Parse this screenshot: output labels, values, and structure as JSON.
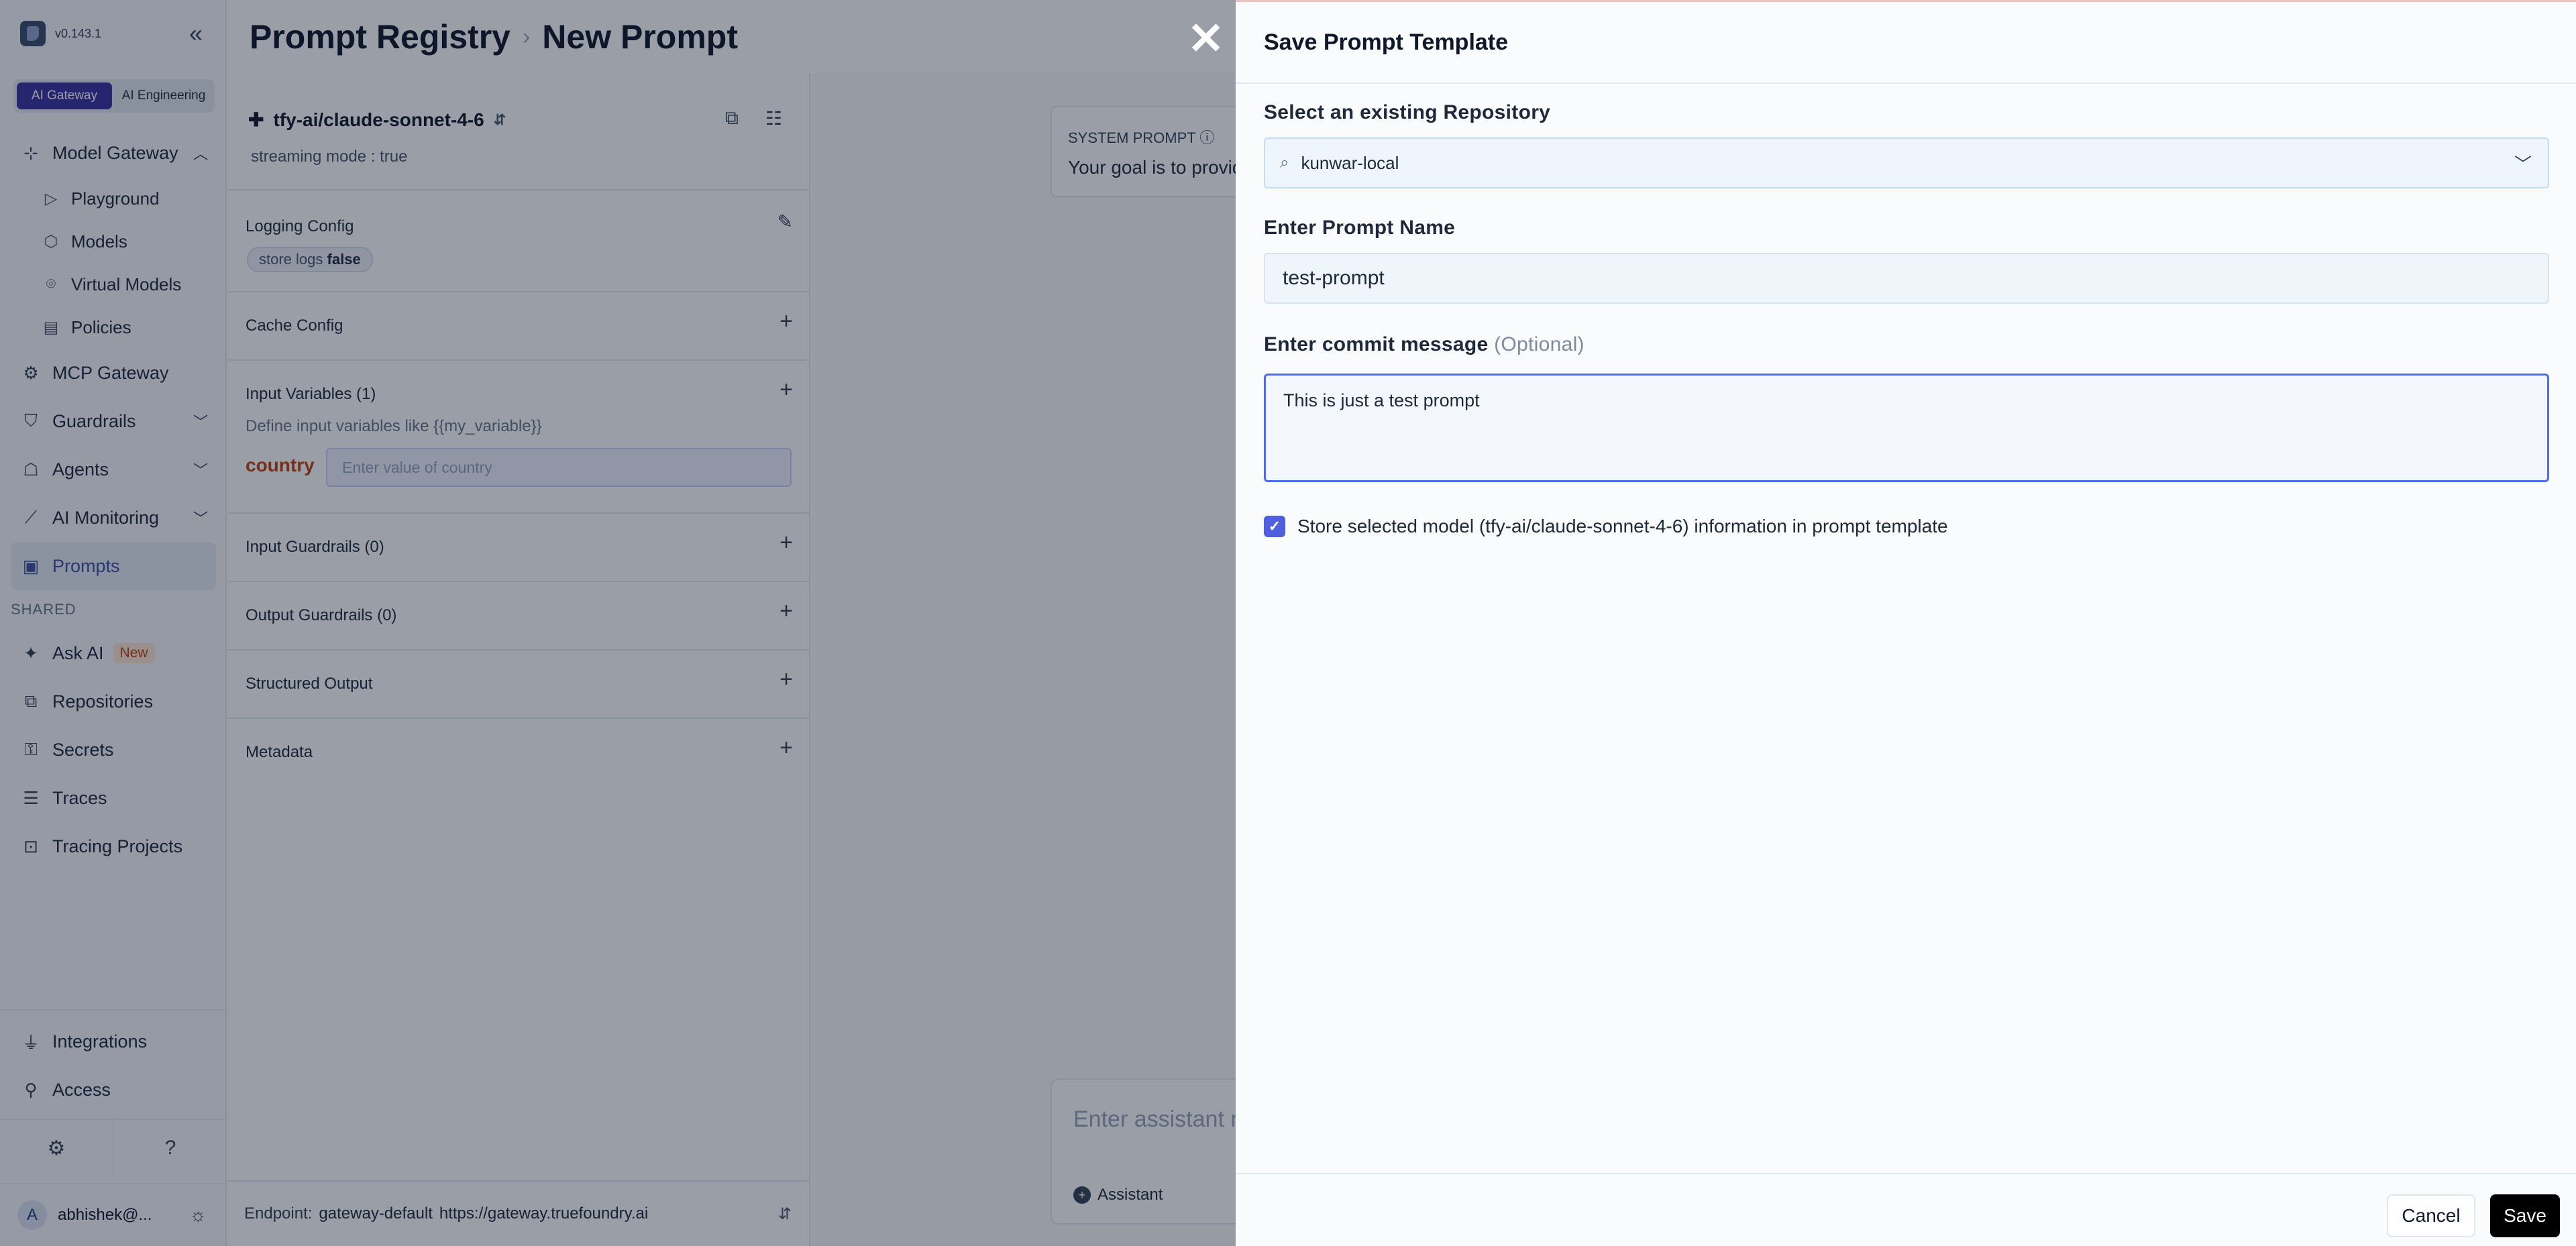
{
  "app": {
    "version": "v0.143.1"
  },
  "segments": [
    "AI Gateway",
    "AI Engineering"
  ],
  "sidebar": {
    "model_gateway": "Model Gateway",
    "sub": [
      "Playground",
      "Models",
      "Virtual Models",
      "Policies"
    ],
    "mcp_gateway": "MCP Gateway",
    "guardrails": "Guardrails",
    "agents": "Agents",
    "ai_monitoring": "AI Monitoring",
    "prompts": "Prompts",
    "shared_label": "SHARED",
    "ask_ai": "Ask AI",
    "new_badge": "New",
    "repositories": "Repositories",
    "secrets": "Secrets",
    "traces": "Traces",
    "tracing_projects": "Tracing Projects",
    "integrations": "Integrations",
    "access": "Access",
    "user": "abhishek@...",
    "avatar_letter": "A"
  },
  "header": {
    "crumb1": "Prompt Registry",
    "crumb2": "New Prompt"
  },
  "config": {
    "model": "tfy-ai/claude-sonnet-4-6",
    "streaming": "streaming mode : true",
    "logging_title": "Logging Config",
    "chip_key": "store logs",
    "chip_val": "false",
    "cache_title": "Cache Config",
    "vars_title": "Input Variables (1)",
    "vars_help": "Define input variables like {{my_variable}}",
    "var_name": "country",
    "var_placeholder": "Enter value of country",
    "input_guardrails": "Input Guardrails (0)",
    "output_guardrails": "Output Guardrails (0)",
    "structured_output": "Structured Output",
    "metadata": "Metadata"
  },
  "endpoint": {
    "label": "Endpoint:",
    "name": "gateway-default",
    "url": "https://gateway.truefoundry.ai"
  },
  "chat": {
    "system_heading": "SYSTEM PROMPT",
    "system_text": "Your goal is to provid",
    "assistant_placeholder": "Enter assistant m",
    "assistant_role": "Assistant"
  },
  "drawer": {
    "title": "Save Prompt Template",
    "repo_label": "Select an existing Repository",
    "repo_value": "kunwar-local",
    "name_label": "Enter Prompt Name",
    "name_value": "test-prompt",
    "commit_label": "Enter commit message",
    "commit_optional": "(Optional)",
    "commit_value": "This is just a test prompt",
    "store_model_text": "Store selected model (tfy-ai/claude-sonnet-4-6) information in prompt template",
    "store_model_checked": true,
    "cancel": "Cancel",
    "save": "Save"
  },
  "colors": {
    "accent": "#4f5fe0",
    "brand": "#3730a3",
    "save_bg": "#000000"
  }
}
